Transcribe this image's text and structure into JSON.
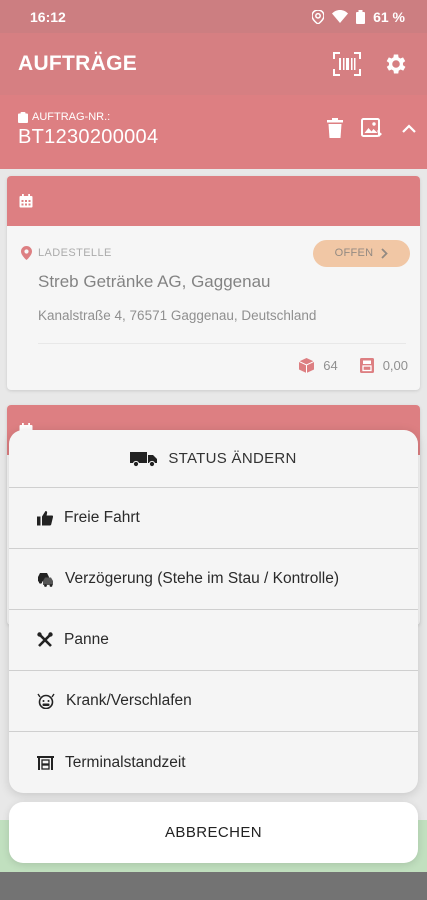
{
  "status_bar": {
    "time": "16:12",
    "battery": "61 %"
  },
  "app_bar": {
    "title": "AUFTRÄGE"
  },
  "order": {
    "label": "AUFTRAG-NR.:",
    "number": "BT1230200004"
  },
  "stop": {
    "location_label": "LADESTELLE",
    "status": "OFFEN",
    "company": "Streb Getränke AG, Gaggenau",
    "address": "Kanalstraße 4, 76571 Gaggenau, Deutschland",
    "packages": "64",
    "amount": "0,00"
  },
  "sheet": {
    "title": "STATUS ÄNDERN",
    "options": [
      {
        "label": "Freie Fahrt",
        "icon": "thumbs-up-icon"
      },
      {
        "label": "Verzögerung (Stehe im Stau / Kontrolle)",
        "icon": "car-traffic-icon"
      },
      {
        "label": "Panne",
        "icon": "tools-icon"
      },
      {
        "label": "Krank/Verschlafen",
        "icon": "sick-face-icon"
      },
      {
        "label": "Terminalstandzeit",
        "icon": "terminal-icon"
      }
    ],
    "cancel": "ABBRECHEN"
  },
  "colors": {
    "primary": "#b5171c",
    "status_pill": "#e59a5c",
    "accent_green": "#8fc68b"
  }
}
